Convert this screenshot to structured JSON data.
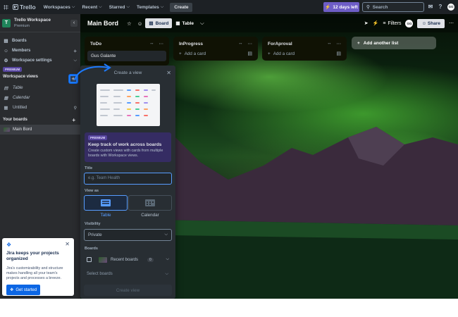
{
  "topbar": {
    "logo": "Trello",
    "workspaces": "Workspaces",
    "recent": "Recent",
    "starred": "Starred",
    "templates": "Templates",
    "create": "Create",
    "trial": "12 days left",
    "search_placeholder": "Search",
    "avatar": "GG"
  },
  "sidebar": {
    "workspace_name": "Trello Workspace",
    "workspace_plan": "Premium",
    "workspace_initial": "T",
    "items": [
      {
        "label": "Boards"
      },
      {
        "label": "Members"
      },
      {
        "label": "Workspace settings"
      }
    ],
    "premium_badge": "PREMIUM",
    "workspace_views": "Workspace views",
    "views": [
      {
        "label": "Table"
      },
      {
        "label": "Calendar"
      },
      {
        "label": "Untitled"
      }
    ],
    "your_boards": "Your boards",
    "board": "Main Bord"
  },
  "jira": {
    "title": "Jira keeps your projects organized",
    "body": "Jira's customizability and structure makes handling all your team's projects and processes a breeze.",
    "button": "Get started"
  },
  "board": {
    "name": "Main Bord",
    "view_board": "Board",
    "view_table": "Table",
    "filters": "Filters",
    "avatar": "GG",
    "share": "Share",
    "lists": [
      {
        "title": "ToDo",
        "cards": [
          "Gus Galante"
        ],
        "add": "Add a card"
      },
      {
        "title": "InProgress",
        "cards": [],
        "add": "Add a card"
      },
      {
        "title": "ForAproval",
        "cards": [],
        "add": "Add a card"
      }
    ],
    "add_list": "Add another list"
  },
  "popover": {
    "title": "Create a view",
    "premium": "PREMIUM",
    "promo_title": "Keep track of work across boards",
    "promo_text": "Create custom views with cards from multiple boards with Workspace views.",
    "title_label": "Title",
    "title_placeholder": "e.g. Team Health",
    "view_as": "View as",
    "table": "Table",
    "calendar": "Calendar",
    "visibility": "Visibility",
    "visibility_value": "Private",
    "boards": "Boards",
    "recent_boards": "Recent boards",
    "recent_count": "0",
    "select_boards": "Select boards",
    "create_button": "Create view"
  },
  "colors": {
    "accent": "#579dff",
    "sidebar": "#2a2c2f",
    "topbar": "#1d2125",
    "trial": "#6e5dc6"
  }
}
